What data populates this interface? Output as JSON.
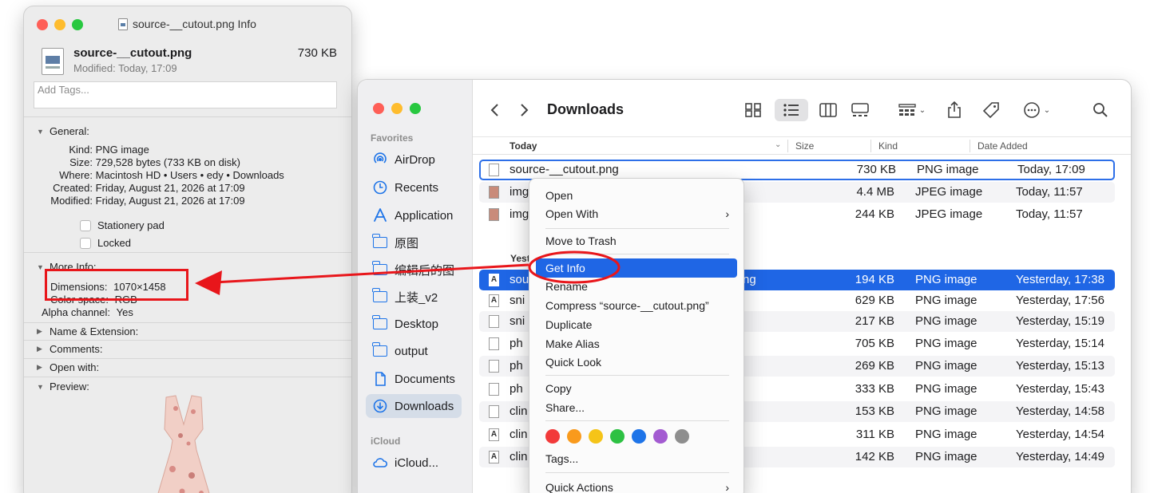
{
  "info_window": {
    "title": "source-__cutout.png Info",
    "file_name": "source-__cutout.png",
    "modified": "Modified: Today, 17:09",
    "size": "730 KB",
    "tags_placeholder": "Add Tags...",
    "general": {
      "header": "General:",
      "kind_label": "Kind:",
      "kind": "PNG image",
      "size_label": "Size:",
      "size": "729,528 bytes (733 KB on disk)",
      "where_label": "Where:",
      "where": "Macintosh HD • Users • edy • Downloads",
      "created_label": "Created:",
      "created": "Friday, August 21, 2026 at 17:09",
      "modified_label": "Modified:",
      "modified": "Friday, August 21, 2026 at 17:09",
      "stationery": "Stationery pad",
      "locked": "Locked"
    },
    "more_info": {
      "header": "More Info:",
      "dimensions_label": "Dimensions:",
      "dimensions": "1070×1458",
      "color_space_label": "Color space:",
      "color_space": "RGB",
      "alpha_label": "Alpha channel:",
      "alpha": "Yes"
    },
    "collapsed_sections": [
      "Name & Extension:",
      "Comments:",
      "Open with:"
    ],
    "preview_header": "Preview:"
  },
  "finder": {
    "title": "Downloads",
    "sidebar": {
      "favorites_label": "Favorites",
      "items": [
        {
          "label": "AirDrop",
          "icon": "airdrop-icon"
        },
        {
          "label": "Recents",
          "icon": "clock-icon"
        },
        {
          "label": "Application",
          "icon": "apps-icon"
        },
        {
          "label": "原图",
          "icon": "folder-icon"
        },
        {
          "label": "编辑后的图",
          "icon": "folder-icon"
        },
        {
          "label": "上装_v2",
          "icon": "folder-icon"
        },
        {
          "label": "Desktop",
          "icon": "folder-icon"
        },
        {
          "label": "output",
          "icon": "folder-icon"
        },
        {
          "label": "Documents",
          "icon": "document-icon"
        },
        {
          "label": "Downloads",
          "icon": "download-icon"
        }
      ],
      "icloud_label": "iCloud",
      "icloud_item": "iCloud..."
    },
    "columns": {
      "name": "Today",
      "size": "Size",
      "kind": "Kind",
      "date": "Date Added"
    },
    "group_yesterday": "Yest",
    "rows": [
      {
        "name": "source-__cutout.png",
        "size": "730 KB",
        "kind": "PNG image",
        "date": "Today, 17:09"
      },
      {
        "name": "img",
        "size": "4.4 MB",
        "kind": "JPEG image",
        "date": "Today, 11:57"
      },
      {
        "name": "img",
        "size": "244 KB",
        "kind": "JPEG image",
        "date": "Today, 11:57"
      },
      {
        "name": "sou",
        "name_tail": "ng",
        "size": "194 KB",
        "kind": "PNG image",
        "date": "Yesterday, 17:38"
      },
      {
        "name": "sni",
        "size": "629 KB",
        "kind": "PNG image",
        "date": "Yesterday, 17:56"
      },
      {
        "name": "sni",
        "size": "217 KB",
        "kind": "PNG image",
        "date": "Yesterday, 15:19"
      },
      {
        "name": "ph",
        "size": "705 KB",
        "kind": "PNG image",
        "date": "Yesterday, 15:14"
      },
      {
        "name": "ph",
        "size": "269 KB",
        "kind": "PNG image",
        "date": "Yesterday, 15:13"
      },
      {
        "name": "ph",
        "size": "333 KB",
        "kind": "PNG image",
        "date": "Yesterday, 15:43"
      },
      {
        "name": "clin",
        "size": "153 KB",
        "kind": "PNG image",
        "date": "Yesterday, 14:58"
      },
      {
        "name": "clin",
        "size": "311 KB",
        "kind": "PNG image",
        "date": "Yesterday, 14:54"
      },
      {
        "name": "clin",
        "size": "142 KB",
        "kind": "PNG image",
        "date": "Yesterday, 14:49"
      }
    ]
  },
  "context_menu": {
    "open": "Open",
    "open_with": "Open With",
    "move_to_trash": "Move to Trash",
    "get_info": "Get Info",
    "rename": "Rename",
    "compress": "Compress “source-__cutout.png”",
    "duplicate": "Duplicate",
    "make_alias": "Make Alias",
    "quick_look": "Quick Look",
    "copy": "Copy",
    "share": "Share...",
    "tags": "Tags...",
    "quick_actions": "Quick Actions",
    "tag_colors": [
      "#f23a3a",
      "#f99a1c",
      "#f5c418",
      "#2dc143",
      "#1e74e8",
      "#a35bd1",
      "#8e8e8e"
    ]
  },
  "annotation_color": "#e8161b"
}
